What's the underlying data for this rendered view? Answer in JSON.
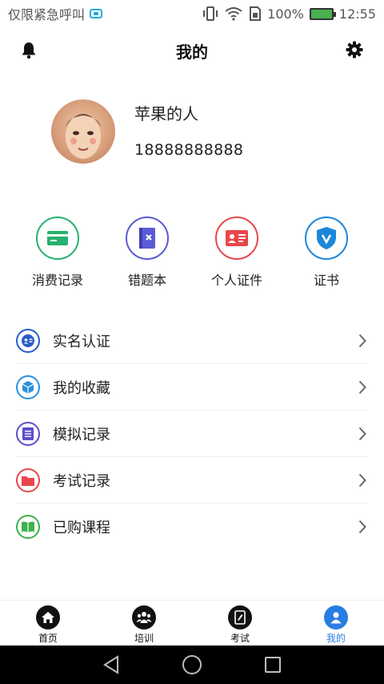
{
  "status_bar": {
    "carrier": "仅限紧急呼叫",
    "battery": "100%",
    "time": "12:55"
  },
  "header": {
    "title": "我的",
    "bell_icon": "bell-icon",
    "settings_icon": "gear-icon"
  },
  "profile": {
    "name": "苹果的人",
    "phone": "18888888888"
  },
  "quick_links": [
    {
      "label": "消费记录",
      "icon": "card-icon",
      "color": "#27b26e"
    },
    {
      "label": "错题本",
      "icon": "notebook-x-icon",
      "color": "#5b5bd6"
    },
    {
      "label": "个人证件",
      "icon": "id-card-icon",
      "color": "#e8474a"
    },
    {
      "label": "证书",
      "icon": "shield-check-icon",
      "color": "#1d86d8"
    }
  ],
  "menu": [
    {
      "label": "实名认证",
      "icon": "id-verify-icon",
      "color": "#2a5cc9"
    },
    {
      "label": "我的收藏",
      "icon": "cube-icon",
      "color": "#2a8fdd"
    },
    {
      "label": "模拟记录",
      "icon": "document-icon",
      "color": "#5a4fc9"
    },
    {
      "label": "考试记录",
      "icon": "folder-icon",
      "color": "#e8474a"
    },
    {
      "label": "已购课程",
      "icon": "book-icon",
      "color": "#3cb34a"
    }
  ],
  "tabs": [
    {
      "label": "首页",
      "icon": "home-icon"
    },
    {
      "label": "培训",
      "icon": "group-icon"
    },
    {
      "label": "考试",
      "icon": "exam-icon"
    },
    {
      "label": "我的",
      "icon": "user-icon"
    }
  ],
  "active_tab": "我的",
  "colors": {
    "accent": "#2a7de1"
  }
}
